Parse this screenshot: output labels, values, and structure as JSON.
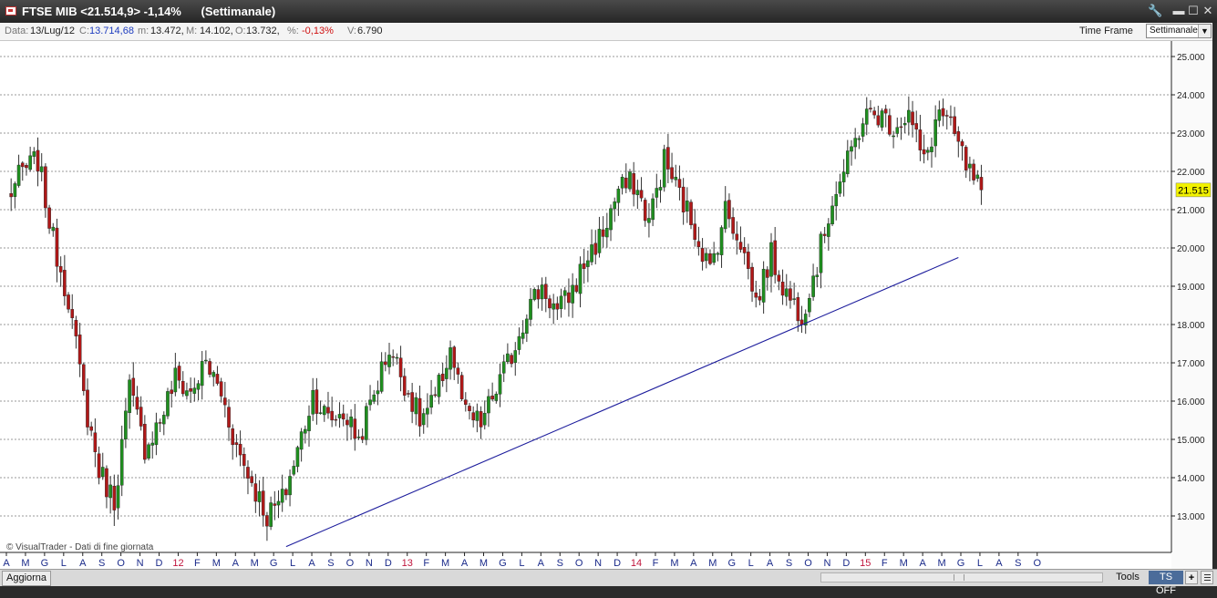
{
  "window": {
    "title": "FTSE MIB <21.514,9> -1,14%      (Settimanale)",
    "controls": {
      "tools_glyph": "🔧",
      "minimize": "▬",
      "maximize": "☐",
      "close": "✕"
    }
  },
  "infobar": {
    "data_label": "Data:",
    "data_value": "13/Lug/12",
    "close_label": "C:",
    "close_value": "13.714,68",
    "min_label": "m:",
    "min_value": "13.472,",
    "max_label": "M:",
    "max_value": "14.102,",
    "open_label": "O:",
    "open_value": "13.732,",
    "pct_label": "%:",
    "pct_value": "-0,13%",
    "vol_label": "V:",
    "vol_value": "6.790",
    "timeframe_label": "Time Frame",
    "timeframe_value": "Settimanale"
  },
  "colors": {
    "up": "#1f8f1f",
    "down": "#b01818",
    "trendline": "#1c1c9c",
    "last_price_bg": "#f2f200",
    "year_label": "#c0143c",
    "month_label": "#1a2a8a"
  },
  "chart_data": {
    "type": "candlestick",
    "instrument": "FTSE MIB",
    "timeframe": "Settimanale",
    "ylim": [
      12000,
      25400
    ],
    "yticks": [
      "25.000",
      "24.000",
      "23.000",
      "22.000",
      "21.000",
      "20.000",
      "19.000",
      "18.000",
      "17.000",
      "16.000",
      "15.000",
      "14.000",
      "13.000"
    ],
    "last_price_label": "21.515",
    "last_price_value": 21515,
    "watermark": "© VisualTrader - Dati di fine giornata",
    "x_labels": [
      "A",
      "M",
      "G",
      "L",
      "A",
      "S",
      "O",
      "N",
      "D",
      "12",
      "F",
      "M",
      "A",
      "M",
      "G",
      "L",
      "A",
      "S",
      "O",
      "N",
      "D",
      "13",
      "F",
      "M",
      "A",
      "M",
      "G",
      "L",
      "A",
      "S",
      "O",
      "N",
      "D",
      "14",
      "F",
      "M",
      "A",
      "M",
      "G",
      "L",
      "A",
      "S",
      "O",
      "N",
      "D",
      "15",
      "F",
      "M",
      "A",
      "M",
      "G",
      "L",
      "A",
      "S",
      "O"
    ],
    "year_labels": [
      "12",
      "13",
      "14",
      "15"
    ],
    "close_anchors": [
      {
        "week": 0,
        "close": 21300
      },
      {
        "week": 4,
        "close": 22000
      },
      {
        "week": 8,
        "close": 22300
      },
      {
        "week": 12,
        "close": 20200
      },
      {
        "week": 16,
        "close": 18700
      },
      {
        "week": 20,
        "close": 16100
      },
      {
        "week": 24,
        "close": 14200
      },
      {
        "week": 28,
        "close": 13400
      },
      {
        "week": 32,
        "close": 16300
      },
      {
        "week": 36,
        "close": 14800
      },
      {
        "week": 40,
        "close": 15500
      },
      {
        "week": 44,
        "close": 16600
      },
      {
        "week": 48,
        "close": 16200
      },
      {
        "week": 52,
        "close": 17000
      },
      {
        "week": 56,
        "close": 16200
      },
      {
        "week": 60,
        "close": 14800
      },
      {
        "week": 64,
        "close": 13900
      },
      {
        "week": 68,
        "close": 13000
      },
      {
        "week": 72,
        "close": 13400
      },
      {
        "week": 76,
        "close": 14700
      },
      {
        "week": 80,
        "close": 16200
      },
      {
        "week": 84,
        "close": 15500
      },
      {
        "week": 88,
        "close": 15700
      },
      {
        "week": 92,
        "close": 15000
      },
      {
        "week": 96,
        "close": 16200
      },
      {
        "week": 100,
        "close": 17400
      },
      {
        "week": 104,
        "close": 16500
      },
      {
        "week": 108,
        "close": 15500
      },
      {
        "week": 112,
        "close": 16000
      },
      {
        "week": 116,
        "close": 17400
      },
      {
        "week": 120,
        "close": 15600
      },
      {
        "week": 124,
        "close": 15400
      },
      {
        "week": 128,
        "close": 16300
      },
      {
        "week": 132,
        "close": 17200
      },
      {
        "week": 136,
        "close": 18400
      },
      {
        "week": 140,
        "close": 19000
      },
      {
        "week": 144,
        "close": 18300
      },
      {
        "week": 148,
        "close": 18900
      },
      {
        "week": 152,
        "close": 19800
      },
      {
        "week": 156,
        "close": 20400
      },
      {
        "week": 160,
        "close": 21500
      },
      {
        "week": 164,
        "close": 21700
      },
      {
        "week": 168,
        "close": 20700
      },
      {
        "week": 172,
        "close": 22300
      },
      {
        "week": 176,
        "close": 21400
      },
      {
        "week": 180,
        "close": 20500
      },
      {
        "week": 184,
        "close": 19400
      },
      {
        "week": 188,
        "close": 21000
      },
      {
        "week": 192,
        "close": 20200
      },
      {
        "week": 196,
        "close": 18600
      },
      {
        "week": 200,
        "close": 19800
      },
      {
        "week": 204,
        "close": 18800
      },
      {
        "week": 208,
        "close": 18300
      },
      {
        "week": 212,
        "close": 19600
      },
      {
        "week": 216,
        "close": 21300
      },
      {
        "week": 220,
        "close": 22200
      },
      {
        "week": 224,
        "close": 23400
      },
      {
        "week": 228,
        "close": 23500
      },
      {
        "week": 232,
        "close": 23200
      },
      {
        "week": 236,
        "close": 23500
      },
      {
        "week": 240,
        "close": 22200
      },
      {
        "week": 244,
        "close": 23600
      },
      {
        "week": 248,
        "close": 22900
      },
      {
        "week": 252,
        "close": 21900
      },
      {
        "week": 255,
        "close": 21515
      }
    ],
    "trendline": {
      "from": {
        "week": 73,
        "value": 12200
      },
      "to": {
        "week": 249,
        "value": 19750
      }
    }
  },
  "bottombar": {
    "aggiorna_label": "Aggiorna",
    "tools_label": "Tools",
    "ts_label": "TS OFF",
    "plus_label": "+"
  }
}
